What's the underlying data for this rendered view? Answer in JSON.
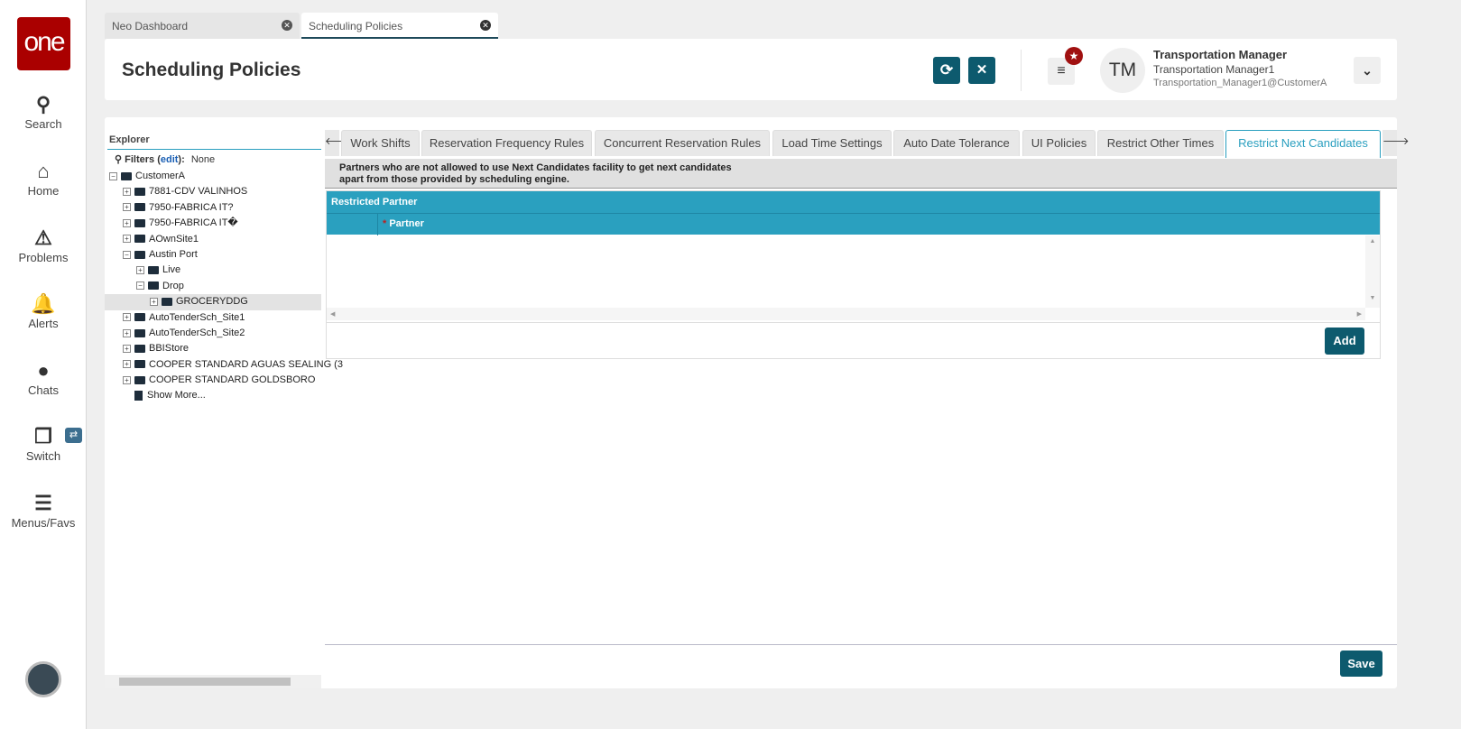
{
  "sidebar": {
    "logo": "one",
    "items": [
      {
        "label": "Search",
        "icon": "search-icon"
      },
      {
        "label": "Home",
        "icon": "home-icon"
      },
      {
        "label": "Problems",
        "icon": "warning-icon"
      },
      {
        "label": "Alerts",
        "icon": "bell-icon"
      },
      {
        "label": "Chats",
        "icon": "chat-icon"
      },
      {
        "label": "Switch",
        "icon": "switch-icon"
      },
      {
        "label": "Menus/Favs",
        "icon": "menu-icon"
      }
    ]
  },
  "doc_tabs": [
    {
      "label": "Neo Dashboard"
    },
    {
      "label": "Scheduling Policies",
      "active": true
    }
  ],
  "header": {
    "title": "Scheduling Policies",
    "user": {
      "initials": "TM",
      "role": "Transportation Manager",
      "name": "Transportation Manager1",
      "email": "Transportation_Manager1@CustomerA"
    }
  },
  "explorer": {
    "title": "Explorer",
    "filters_label": "Filters (",
    "filters_edit": "edit",
    "filters_close": "):",
    "filters_value": "None",
    "tree": [
      {
        "label": "CustomerA",
        "level": 0,
        "open": true
      },
      {
        "label": "7881-CDV VALINHOS",
        "level": 1
      },
      {
        "label": "7950-FABRICA IT?",
        "level": 1
      },
      {
        "label": "7950-FABRICA IT�",
        "level": 1
      },
      {
        "label": "AOwnSite1",
        "level": 1
      },
      {
        "label": "Austin Port",
        "level": 1,
        "open": true
      },
      {
        "label": "Live",
        "level": 2
      },
      {
        "label": "Drop",
        "level": 2,
        "open": true
      },
      {
        "label": "GROCERYDDG",
        "level": 3,
        "selected": true
      },
      {
        "label": "AutoTenderSch_Site1",
        "level": 1
      },
      {
        "label": "AutoTenderSch_Site2",
        "level": 1
      },
      {
        "label": "BBIStore",
        "level": 1
      },
      {
        "label": "COOPER STANDARD AGUAS SEALING (3",
        "level": 1
      },
      {
        "label": "COOPER STANDARD GOLDSBORO",
        "level": 1
      }
    ],
    "show_more": "Show More..."
  },
  "tabs": [
    {
      "label": "Work Shifts"
    },
    {
      "label": "Reservation Frequency Rules"
    },
    {
      "label": "Concurrent Reservation Rules"
    },
    {
      "label": "Load Time Settings"
    },
    {
      "label": "Auto Date Tolerance"
    },
    {
      "label": "UI Policies"
    },
    {
      "label": "Restrict Other Times"
    },
    {
      "label": "Restrict Next Candidates",
      "active": true
    }
  ],
  "description": [
    "Partners who are not allowed to use Next Candidates facility to get next candidates",
    "apart from those provided by scheduling engine."
  ],
  "grid": {
    "title": "Restricted Partner",
    "required_mark": "*",
    "column": "Partner"
  },
  "buttons": {
    "add": "Add",
    "save": "Save"
  },
  "colors": {
    "brand": "#aa0000",
    "accent": "#2aa0bf",
    "button": "#0d5a6e"
  }
}
